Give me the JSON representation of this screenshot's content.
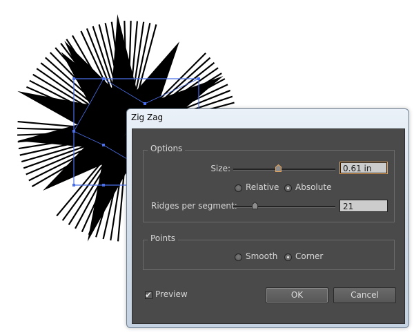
{
  "dialog": {
    "title": "Zig Zag"
  },
  "options": {
    "group_title": "Options",
    "size_label": "Size:",
    "size_value": "0.61 in",
    "size_slider_fraction": 0.44,
    "mode": {
      "relative_label": "Relative",
      "absolute_label": "Absolute",
      "selected": "Absolute"
    },
    "ridges_label": "Ridges per segment:",
    "ridges_value": "21",
    "ridges_slider_fraction": 0.21
  },
  "points": {
    "group_title": "Points",
    "smooth_label": "Smooth",
    "corner_label": "Corner",
    "selected": "Corner"
  },
  "preview": {
    "label": "Preview",
    "checked": true
  },
  "buttons": {
    "ok_label": "OK",
    "cancel_label": "Cancel"
  },
  "colors": {
    "panel_background": "#4a4a4a",
    "focus_accent": "#e8a45a",
    "selection_path": "#4a6fe8"
  }
}
